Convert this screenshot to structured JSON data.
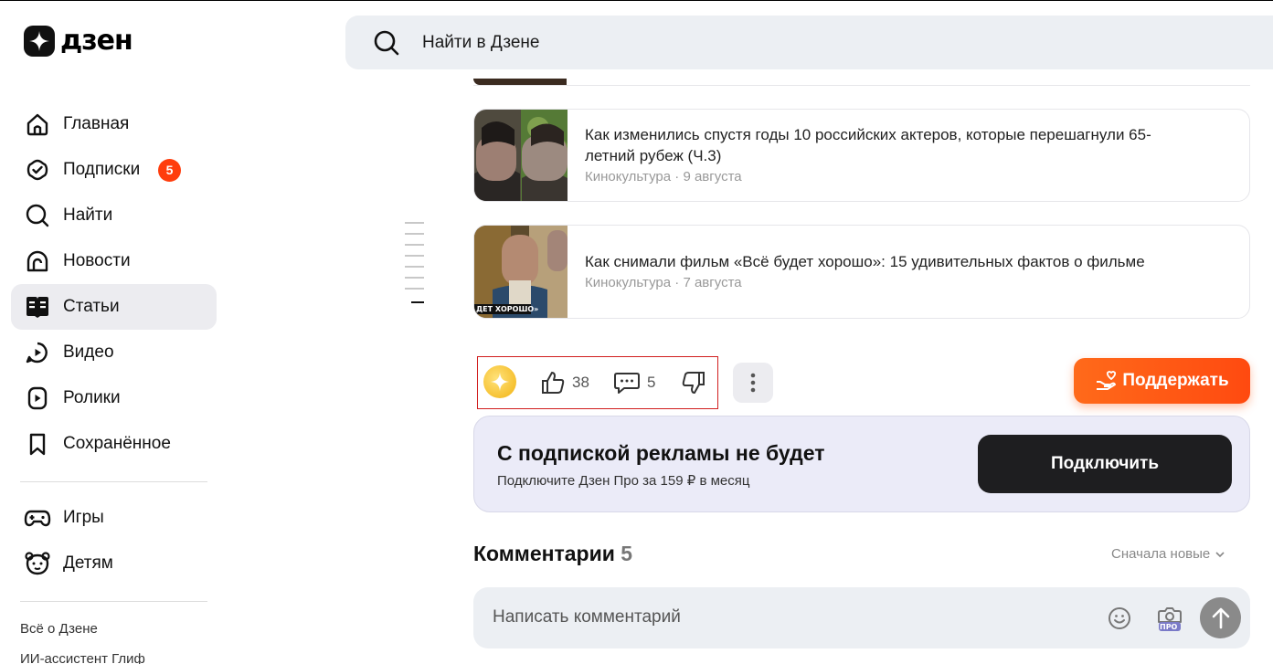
{
  "header": {
    "logo_text": "дзен",
    "search_placeholder": "Найти в Дзене"
  },
  "sidebar": {
    "items": [
      {
        "label": "Главная",
        "icon": "home-icon"
      },
      {
        "label": "Подписки",
        "icon": "subscriptions-icon",
        "badge": "5"
      },
      {
        "label": "Найти",
        "icon": "search-icon"
      },
      {
        "label": "Новости",
        "icon": "news-icon"
      },
      {
        "label": "Статьи",
        "icon": "articles-icon",
        "active": true
      },
      {
        "label": "Видео",
        "icon": "video-icon"
      },
      {
        "label": "Ролики",
        "icon": "shorts-icon"
      },
      {
        "label": "Сохранённое",
        "icon": "bookmark-icon"
      },
      {
        "label": "Игры",
        "icon": "gamepad-icon"
      },
      {
        "label": "Детям",
        "icon": "kids-icon"
      }
    ],
    "footer_links": [
      "Всё о Дзене",
      "ИИ-ассистент Глиф"
    ]
  },
  "articles": [
    {
      "title": "Как изменились спустя годы 10 российских актеров, которые перешагнули 65-летний рубеж (Ч.3)",
      "source": "Кинокультура",
      "date": "9 августа"
    },
    {
      "title": "Как снимали фильм «Всё будет хорошо»: 15 удивительных фактов о фильме",
      "source": "Кинокультура",
      "date": "7 августа",
      "thumb_caption": "ДЕТ ХОРОШО»"
    }
  ],
  "reactions": {
    "likes": "38",
    "comments": "5"
  },
  "support_button": "Поддержать",
  "promo": {
    "title": "С подпиской рекламы не будет",
    "subtitle": "Подключите Дзен Про за 159 ₽ в месяц",
    "button": "Подключить"
  },
  "comments": {
    "title": "Комментарии",
    "count": "5",
    "sort_label": "Сначала новые",
    "input_placeholder": "Написать комментарий",
    "pro_label": "ПРО"
  },
  "colors": {
    "accent_orange": "#ff4a10",
    "badge_red": "#ff3d0d",
    "promo_bg": "#ebebf8",
    "dark_button": "#1e1e20"
  }
}
